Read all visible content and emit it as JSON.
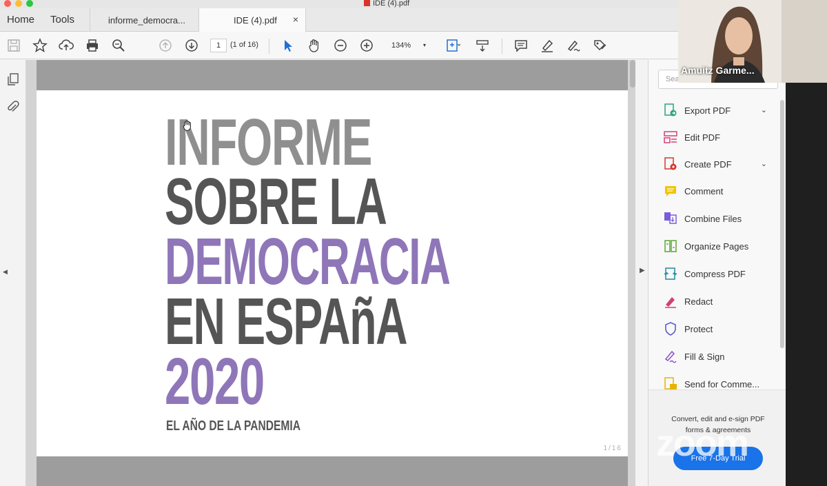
{
  "window": {
    "title": "IDE (4).pdf"
  },
  "nav": {
    "home": "Home",
    "tools": "Tools"
  },
  "tabs": [
    {
      "label": "informe_democra..."
    },
    {
      "label": "IDE (4).pdf",
      "close": "×"
    }
  ],
  "toolbar": {
    "page_value": "1",
    "page_of": "(1 of 16)",
    "zoom": "134%",
    "zoom_caret": "▾"
  },
  "document": {
    "line1": "INFORME",
    "line2": "SOBRE LA",
    "line3": "DEMOCRACIA",
    "line4": "EN ESPAñA",
    "line5": "2020",
    "subtitle": "EL AÑO DE LA PANDEMIA",
    "footer": "1/16",
    "colors": {
      "gray_light": "#8f8f8f",
      "gray_dark": "#555555",
      "purple": "#8f76b8"
    }
  },
  "right_pane": {
    "search_placeholder": "Sea",
    "tools": [
      {
        "label": "Export PDF",
        "icon": "export-pdf-icon",
        "chevron": "⌄"
      },
      {
        "label": "Edit PDF",
        "icon": "edit-pdf-icon"
      },
      {
        "label": "Create PDF",
        "icon": "create-pdf-icon",
        "chevron": "⌄"
      },
      {
        "label": "Comment",
        "icon": "comment-icon"
      },
      {
        "label": "Combine Files",
        "icon": "combine-files-icon"
      },
      {
        "label": "Organize Pages",
        "icon": "organize-pages-icon"
      },
      {
        "label": "Compress PDF",
        "icon": "compress-pdf-icon"
      },
      {
        "label": "Redact",
        "icon": "redact-icon"
      },
      {
        "label": "Protect",
        "icon": "protect-icon"
      },
      {
        "label": "Fill & Sign",
        "icon": "fill-sign-icon"
      },
      {
        "label": "Send for Comme...",
        "icon": "send-for-comment-icon"
      }
    ],
    "promo_text": "Convert, edit and e-sign PDF forms & agreements",
    "trial_button": "Free 7-Day Trial"
  },
  "webcam": {
    "name": "Amuitz Garme..."
  },
  "overlay": {
    "zoom_watermark": "zoom"
  }
}
